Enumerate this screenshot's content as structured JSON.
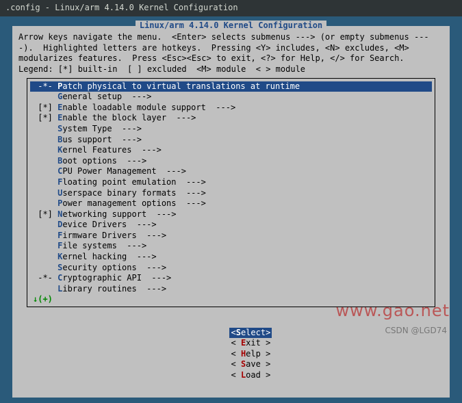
{
  "window": {
    "title": ".config - Linux/arm 4.14.0 Kernel Configuration"
  },
  "dialog": {
    "title": "Linux/arm 4.14.0 Kernel Configuration",
    "help": "Arrow keys navigate the menu.  <Enter> selects submenus ---> (or empty submenus ----).  Highlighted letters are hotkeys.  Pressing <Y> includes, <N> excludes, <M> modularizes features.  Press <Esc><Esc> to exit, <?> for Help, </> for Search.  Legend: [*] built-in  [ ] excluded  <M> module  < > module"
  },
  "menu": {
    "scroll_indicator": "↓(+)",
    "items": [
      {
        "bracket": "-*-",
        "hotkey": "P",
        "rest": "atch physical to virtual translations at runtime",
        "arrow": "",
        "selected": true
      },
      {
        "bracket": "",
        "hotkey": "G",
        "rest": "eneral setup  --->",
        "arrow": "",
        "selected": false
      },
      {
        "bracket": "[*]",
        "hotkey": "E",
        "rest": "nable loadable module support  --->",
        "arrow": "",
        "selected": false
      },
      {
        "bracket": "[*]",
        "hotkey": "E",
        "rest": "nable the block layer  --->",
        "arrow": "",
        "selected": false
      },
      {
        "bracket": "",
        "hotkey": "S",
        "rest": "ystem Type  --->",
        "arrow": "",
        "selected": false
      },
      {
        "bracket": "",
        "hotkey": "B",
        "rest": "us support  --->",
        "arrow": "",
        "selected": false
      },
      {
        "bracket": "",
        "hotkey": "K",
        "rest": "ernel Features  --->",
        "arrow": "",
        "selected": false
      },
      {
        "bracket": "",
        "hotkey": "B",
        "rest": "oot options  --->",
        "arrow": "",
        "selected": false
      },
      {
        "bracket": "",
        "hotkey": "C",
        "rest": "PU Power Management  --->",
        "arrow": "",
        "selected": false
      },
      {
        "bracket": "",
        "hotkey": "F",
        "rest": "loating point emulation  --->",
        "arrow": "",
        "selected": false
      },
      {
        "bracket": "",
        "hotkey": "U",
        "rest": "serspace binary formats  --->",
        "arrow": "",
        "selected": false
      },
      {
        "bracket": "",
        "hotkey": "P",
        "rest": "ower management options  --->",
        "arrow": "",
        "selected": false
      },
      {
        "bracket": "[*]",
        "hotkey": "N",
        "rest": "etworking support  --->",
        "arrow": "",
        "selected": false
      },
      {
        "bracket": "",
        "hotkey": "D",
        "rest": "evice Drivers  --->",
        "arrow": "",
        "selected": false
      },
      {
        "bracket": "",
        "hotkey": "F",
        "rest": "irmware Drivers  --->",
        "arrow": "",
        "selected": false
      },
      {
        "bracket": "",
        "hotkey": "F",
        "rest": "ile systems  --->",
        "arrow": "",
        "selected": false
      },
      {
        "bracket": "",
        "hotkey": "K",
        "rest": "ernel hacking  --->",
        "arrow": "",
        "selected": false
      },
      {
        "bracket": "",
        "hotkey": "S",
        "rest": "ecurity options  --->",
        "arrow": "",
        "selected": false
      },
      {
        "bracket": "-*-",
        "hotkey": "C",
        "rest": "ryptographic API  --->",
        "arrow": "",
        "selected": false
      },
      {
        "bracket": "",
        "hotkey": "L",
        "rest": "ibrary routines  --->",
        "arrow": "",
        "selected": false
      }
    ]
  },
  "buttons": {
    "select": {
      "open": "<",
      "hk": "S",
      "rest": "elect",
      "close": ">"
    },
    "exit": {
      "open": "< ",
      "hk": "E",
      "rest": "xit ",
      "close": ">"
    },
    "help": {
      "open": "< ",
      "hk": "H",
      "rest": "elp ",
      "close": ">"
    },
    "save": {
      "open": "< ",
      "hk": "S",
      "rest": "ave ",
      "close": ">"
    },
    "load": {
      "open": "< ",
      "hk": "L",
      "rest": "oad ",
      "close": ">"
    }
  },
  "watermarks": {
    "bg": "www.gao.net",
    "fg": "CSDN @LGD74"
  }
}
